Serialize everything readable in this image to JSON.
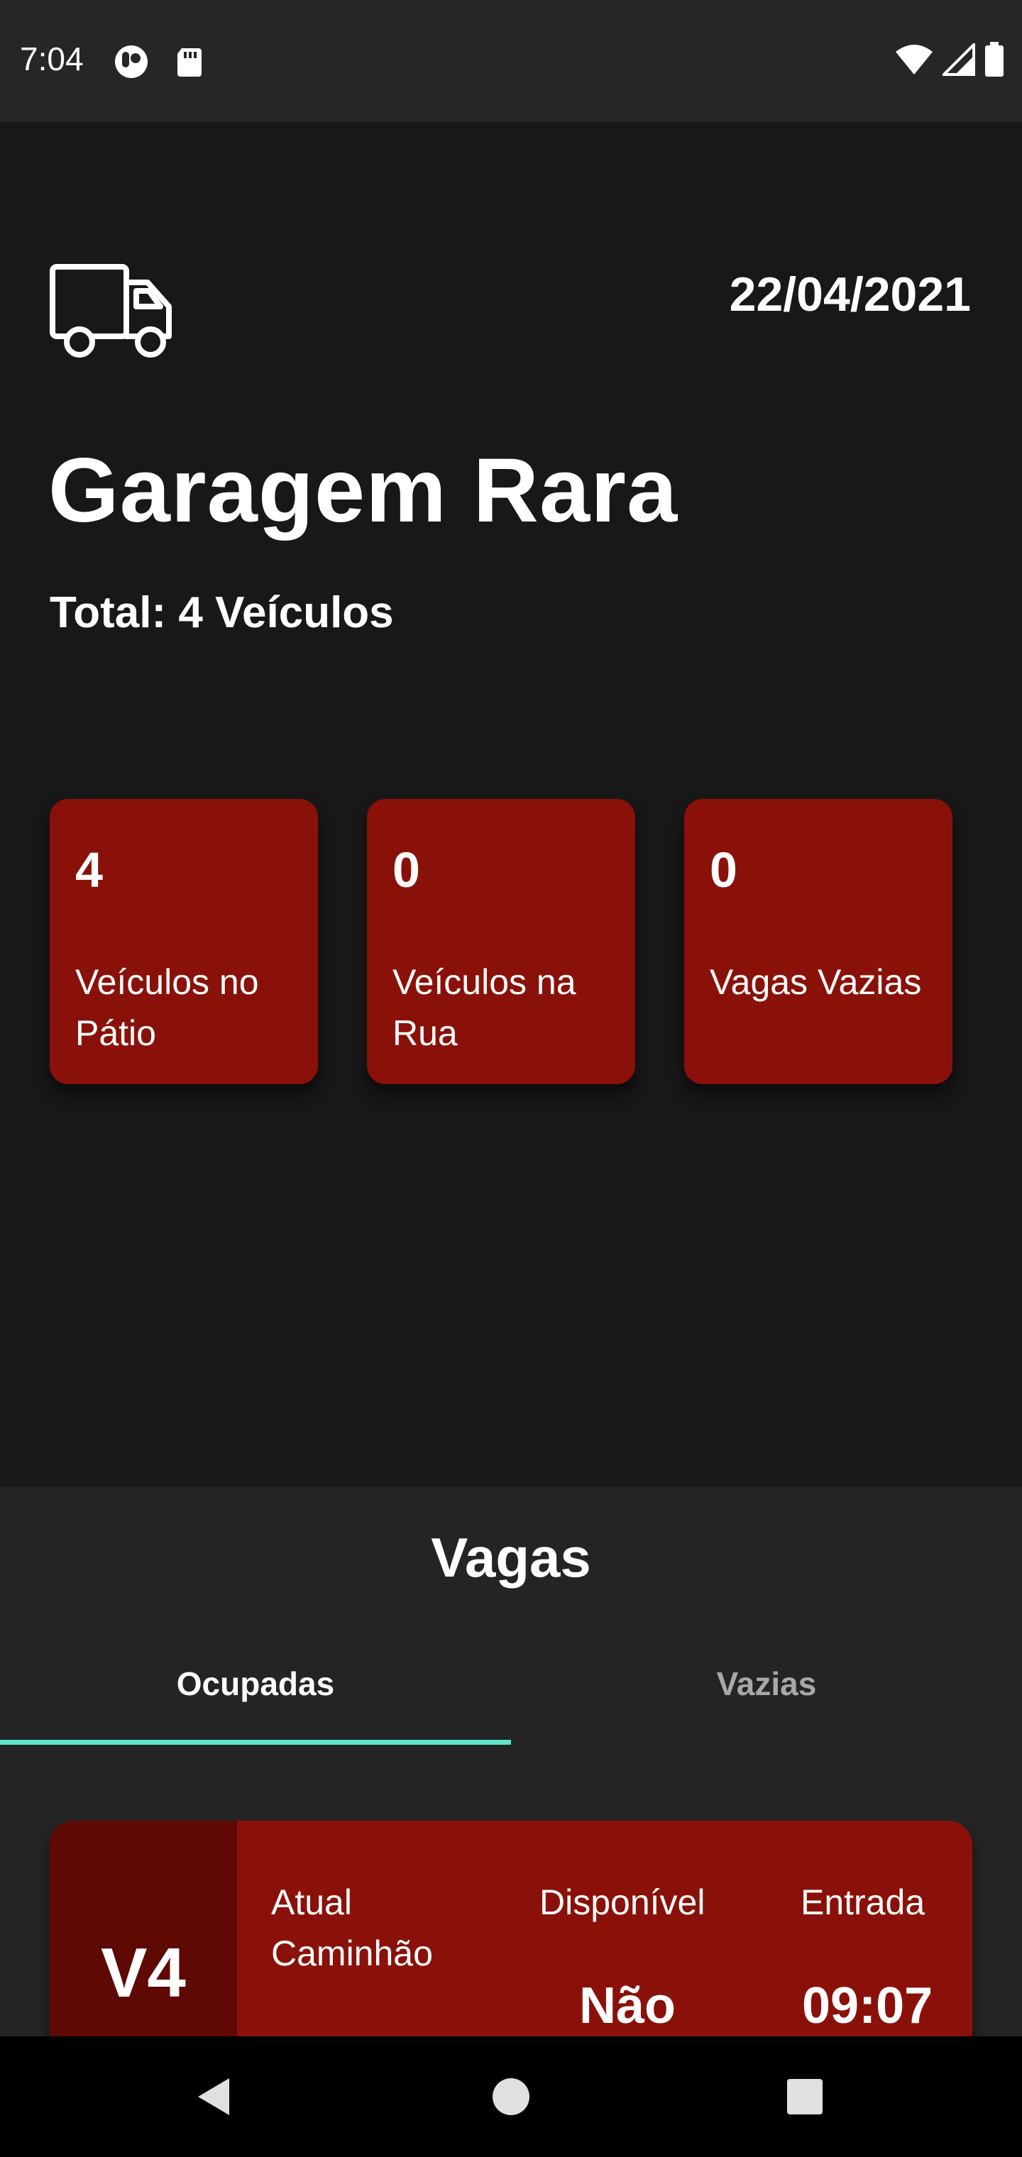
{
  "status_bar": {
    "time": "7:04",
    "icons": [
      "app-notification-icon",
      "sd-card-icon",
      "wifi-icon",
      "signal-icon",
      "battery-icon"
    ]
  },
  "header": {
    "icon": "truck-icon",
    "date": "22/04/2021",
    "title": "Garagem Rara",
    "total": "Total: 4 Veículos"
  },
  "stats": [
    {
      "value": "4",
      "label": "Veículos no Pátio"
    },
    {
      "value": "0",
      "label": "Veículos na Rua"
    },
    {
      "value": "0",
      "label": "Vagas Vazias"
    }
  ],
  "vagas": {
    "title": "Vagas",
    "tabs": [
      {
        "label": "Ocupadas",
        "active": true
      },
      {
        "label": "Vazias",
        "active": false
      }
    ],
    "items": [
      {
        "code": "V4",
        "status_label": "Atual",
        "vehicle_type": "Caminhão",
        "available_label": "Disponível",
        "available_value": "Não",
        "entry_label": "Entrada",
        "entry_value": "09:07"
      }
    ]
  },
  "nav": {
    "icons": [
      "back-icon",
      "home-icon",
      "recents-icon"
    ]
  },
  "colors": {
    "background": "#181818",
    "card_red": "#8a1109",
    "card_dark_red": "#5e0904",
    "panel": "#242424",
    "tab_indicator": "#5ee3cd"
  }
}
